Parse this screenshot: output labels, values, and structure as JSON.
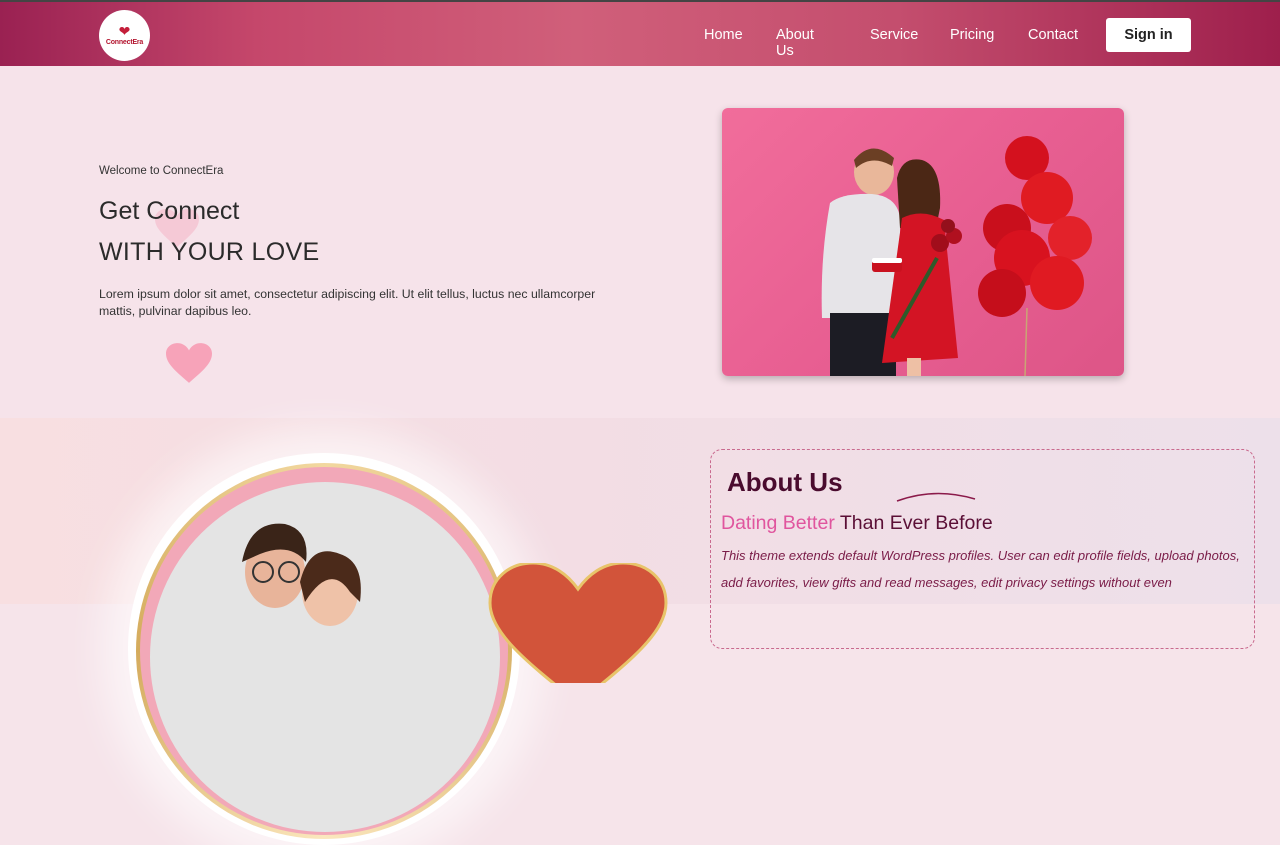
{
  "brand": {
    "logo_text": "ConnectEra"
  },
  "nav": {
    "items": [
      {
        "label": "Home"
      },
      {
        "label": "About Us"
      },
      {
        "label": "Service"
      },
      {
        "label": "Pricing"
      },
      {
        "label": "Contact"
      }
    ],
    "signin_label": "Sign in"
  },
  "hero": {
    "welcome": "Welcome to ConnectEra",
    "title_line1": "Get Connect",
    "title_line2": "WITH YOUR LOVE",
    "description": "Lorem ipsum dolor sit amet, consectetur adipiscing elit. Ut elit tellus, luctus nec ullamcorper mattis, pulvinar dapibus leo."
  },
  "about": {
    "title": "About Us",
    "subtitle_highlight": "Dating Better",
    "subtitle_rest": " Than Ever Before",
    "text": "This theme extends default WordPress profiles. User can edit profile fields, upload photos, add favorites, view gifts and read messages, edit privacy settings without even"
  },
  "colors": {
    "header_start": "#9a2152",
    "header_mid": "#d05f7a",
    "accent_pink": "#e0559e",
    "dark_maroon": "#4a0b2e",
    "hero_bg": "#f6e3ea"
  },
  "icons": [
    "heart-icon",
    "balloon-icon"
  ]
}
